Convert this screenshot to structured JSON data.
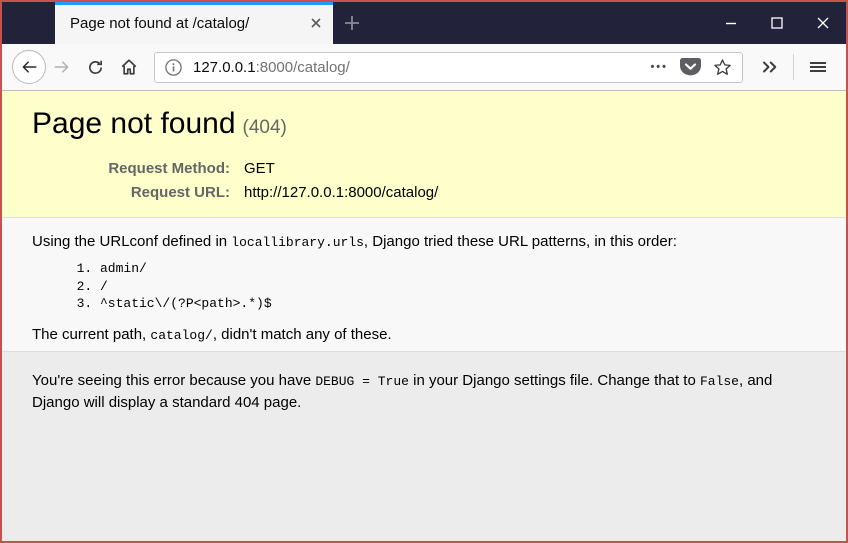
{
  "window": {
    "tab": {
      "title": "Page not found at /catalog/"
    },
    "controls": {
      "minimize": "minimize",
      "maximize": "maximize",
      "close": "close"
    }
  },
  "toolbar": {
    "page_actions_dots": "•••",
    "url": {
      "host": "127.0.0.1",
      "rest": ":8000/catalog/"
    }
  },
  "page": {
    "summary": {
      "heading": "Page not found",
      "status_code": "(404)",
      "rows": [
        {
          "label": "Request Method:",
          "value": "GET"
        },
        {
          "label": "Request URL:",
          "value": "http://127.0.0.1:8000/catalog/"
        }
      ]
    },
    "info": {
      "intro_prefix": "Using the URLconf defined in ",
      "intro_code": "locallibrary.urls",
      "intro_suffix": ", Django tried these URL patterns, in this order:",
      "patterns": [
        "admin/",
        "/",
        "^static\\/(?P<path>.*)$"
      ],
      "current_prefix": "The current path, ",
      "current_code": "catalog/",
      "current_suffix": ", didn't match any of these."
    },
    "explanation": {
      "part1": "You're seeing this error because you have ",
      "code1": "DEBUG = True",
      "part2": " in your Django settings file. Change that to ",
      "code2": "False",
      "part3": ", and Django will display a standard 404 page."
    }
  },
  "colors": {
    "titlebar_bg": "#23223b",
    "tab_accent_blue": "#1d9bfe",
    "summary_yellow": "#ffffcc",
    "info_bg": "#f8f8f8",
    "explanation_bg": "#ececec",
    "screenshot_border": "#c9504c"
  }
}
